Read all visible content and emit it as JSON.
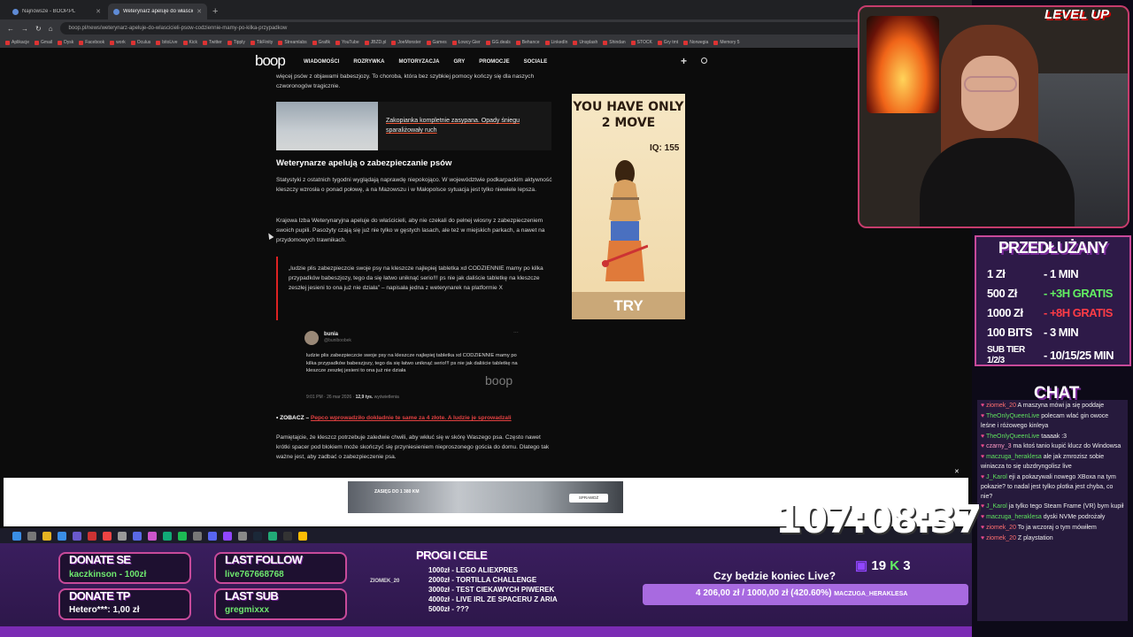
{
  "browser": {
    "tabs": [
      {
        "label": "Najnowsze - BOOP.PL",
        "active": false
      },
      {
        "label": "Weterynarz apeluje do właściciel",
        "active": true
      }
    ],
    "url": "boop.pl/news/weterynarz-apeluje-do-wlascicieli-psow-codziennie-mamy-po-kilka-przypadkow",
    "bookmarks": [
      "Aplikacje",
      "Gmail",
      "Dysk",
      "Facebook",
      "work",
      "Oculus",
      "bitoLive",
      "Kick",
      "Twitter",
      "Tipply",
      "TikFinity",
      "Streamlabs",
      "Grafik",
      "YouTube",
      "JBZD.pl",
      "JoeMonster",
      "Games",
      "Łowcy Gier",
      "GG.deals",
      "Behance",
      "LinkedIn",
      "Unsplash",
      "Shindan",
      "STOCK",
      "Gry tmt",
      "Norwegia",
      "Memory 5"
    ]
  },
  "site": {
    "logo": "boop",
    "nav": [
      "WIADOMOŚCI",
      "ROZRYWKA",
      "MOTORYZACJA",
      "GRY",
      "PROMOCJE",
      "SOCIALE"
    ]
  },
  "article": {
    "intro": "więcej psów z objawami babeszjozy. To choroba, która bez szybkiej pomocy kończy się dla naszych czworonogów tragicznie.",
    "related_title": "Zakopianka kompletnie zasypana. Opady śniegu sparaliżowały ruch",
    "heading": "Weterynarze apelują o zabezpieczanie psów",
    "para1": "Statystyki z ostatnich tygodni wyglądają naprawdę niepokojąco. W województwie podkarpackim aktywność kleszczy wzrosła o ponad połowę, a na Mazowszu i w Małopolsce sytuacja jest tylko niewiele lepsza.",
    "para2": "Krajowa Izba Weterynaryjna apeluje do właścicieli, aby nie czekali do pełnej wiosny z zabezpieczeniem swoich pupili. Pasożyty czają się już nie tylko w gęstych lasach, ale też w miejskich parkach, a nawet na przydomowych trawnikach.",
    "quote": "„ludzie plis zabezpieczcie swoje psy na kleszcze najlepiej tabletka xd CODZIENNIE mamy po kilka przypadków babeszjozy, tego da się łatwo uniknąć serio!!! ps nie jak daliście tabletkę na kleszcze zeszłej jesieni to ona już nie działa” – napisała jedna z weterynarek na platformie X",
    "tweet": {
      "name": "bunia",
      "handle": "@buniboobek",
      "text": "ludzie plis zabezpieczcie swoje psy na kleszcze najlepiej tabletka xd CODZIENNIE mamy po kilka przypadków babeszjozy, tego da się łatwo uniknąć serio!!! ps nie jak daliście tabletkę na kleszcze zeszłej jesieni to ona już nie działa",
      "time": "9:01 PM · 26 mar 2026 ·",
      "views": "12,9 tys.",
      "views_label": "wyświetlenia",
      "watermark": "boop"
    },
    "zobacz_prefix": "• ZOBACZ – ",
    "zobacz_link": "Pepco wprowadziło dokładnie te same za 4 złote. A ludzie je sprowadzali",
    "para3": "Pamiętajcie, że kleszcz potrzebuje zaledwie chwili, aby wkłuć się w skórę Waszego psa. Często nawet krótki spacer pod blokiem może skończyć się przyniesieniem nieproszonego gościa do domu. Dlatego tak ważne jest, aby zadbać o zabezpieczenie psa."
  },
  "ad": {
    "headline": "YOU HAVE ONLY 2 MOVE",
    "iq": "IQ: 155",
    "cta": "TRY"
  },
  "bottom_ad": {
    "text": "ZASIĘG DO 1 380 KM",
    "cta": "SPRAWDŹ"
  },
  "stream": {
    "levelup": "LEVEL UP",
    "subs_title": "PRZEDŁUŻANY",
    "subs": [
      {
        "amount": "1 Zł",
        "value": "- 1 MIN",
        "color": "white"
      },
      {
        "amount": "500 Zł",
        "value": "- +3H GRATIS",
        "color": "green"
      },
      {
        "amount": "1000 Zł",
        "value": "- +8H GRATIS",
        "color": "red"
      },
      {
        "amount": "100 BITS",
        "value": "- 3 MIN",
        "color": "white"
      },
      {
        "amount": "SUB TIER 1/2/3",
        "value": "- 10/15/25 MIN",
        "color": "white"
      }
    ],
    "chat_title": "CHAT",
    "chat": [
      {
        "user": "ziomek_20",
        "msg": "A maszyna mówi ja się poddaje",
        "color": "rd"
      },
      {
        "user": "TheOnlyQueenLive",
        "msg": "polecam wlać gin owoce leśne i różowego kinleya",
        "color": "g"
      },
      {
        "user": "TheOnlyQueenLive",
        "msg": "taaaak :3",
        "color": "g"
      },
      {
        "user": "czarny_3",
        "msg": "ma ktoś tanio kupić klucz do Windowsa",
        "color": "pk"
      },
      {
        "user": "maczuga_heraklesa",
        "msg": "ale jak zmrozisz sobie winiacza to się ubzdryngolisz live",
        "color": "g"
      },
      {
        "user": "J_Karol",
        "msg": "eji a pokazywali nowego XBoxa na tym pokazie? to nadal jest tylko plotka jest chyba, co nie?",
        "color": "g"
      },
      {
        "user": "J_Karol",
        "msg": "ja tylko tego Steam Frame (VR) bym kupił",
        "color": "g"
      },
      {
        "user": "maczuga_heraklesa",
        "msg": "dyski NVMe podrożały",
        "color": "g"
      },
      {
        "user": "ziomek_20",
        "msg": "To ja wczoraj o tym mówiłem",
        "color": "rd"
      },
      {
        "user": "ziomek_20",
        "msg": "Z playstation",
        "color": "rd"
      }
    ],
    "donate_se_label": "DONATE SE",
    "donate_se_value": "kaczkinson - 100zł",
    "donate_tp_label": "DONATE TP",
    "donate_tp_value": "Hetero***: 1,00 zł",
    "last_follow_label": "LAST FOLLOW",
    "last_follow_value": "live767668768",
    "last_sub_label": "LAST SUB",
    "last_sub_value": "gregmixxx",
    "goals_title": "PROGI I CELE",
    "goals_user": "ZIOMEK_20",
    "goals": [
      "1000zł - LEGO ALIEXPRES",
      "2000zł - TORTILLA CHALLENGE",
      "3000zł - TEST CIEKAWYCH PIWEREK",
      "4000zł - LIVE IRL ZE SPACERU Z ARIA",
      "5000zł - ???"
    ],
    "goal_question": "Czy będzie koniec Live?",
    "goal_progress": "4 206,00 zł / 1000,00 zł (420.60%)",
    "goal_progress_fraction": 1.0,
    "goal_ticker": "MACZUGA_HERAKLESA",
    "viewers": "19",
    "kick_count": "3",
    "timer": "107:08:37"
  },
  "colors": {
    "accent": "#c84a9a",
    "link": "#e24040",
    "green": "#62f062"
  }
}
